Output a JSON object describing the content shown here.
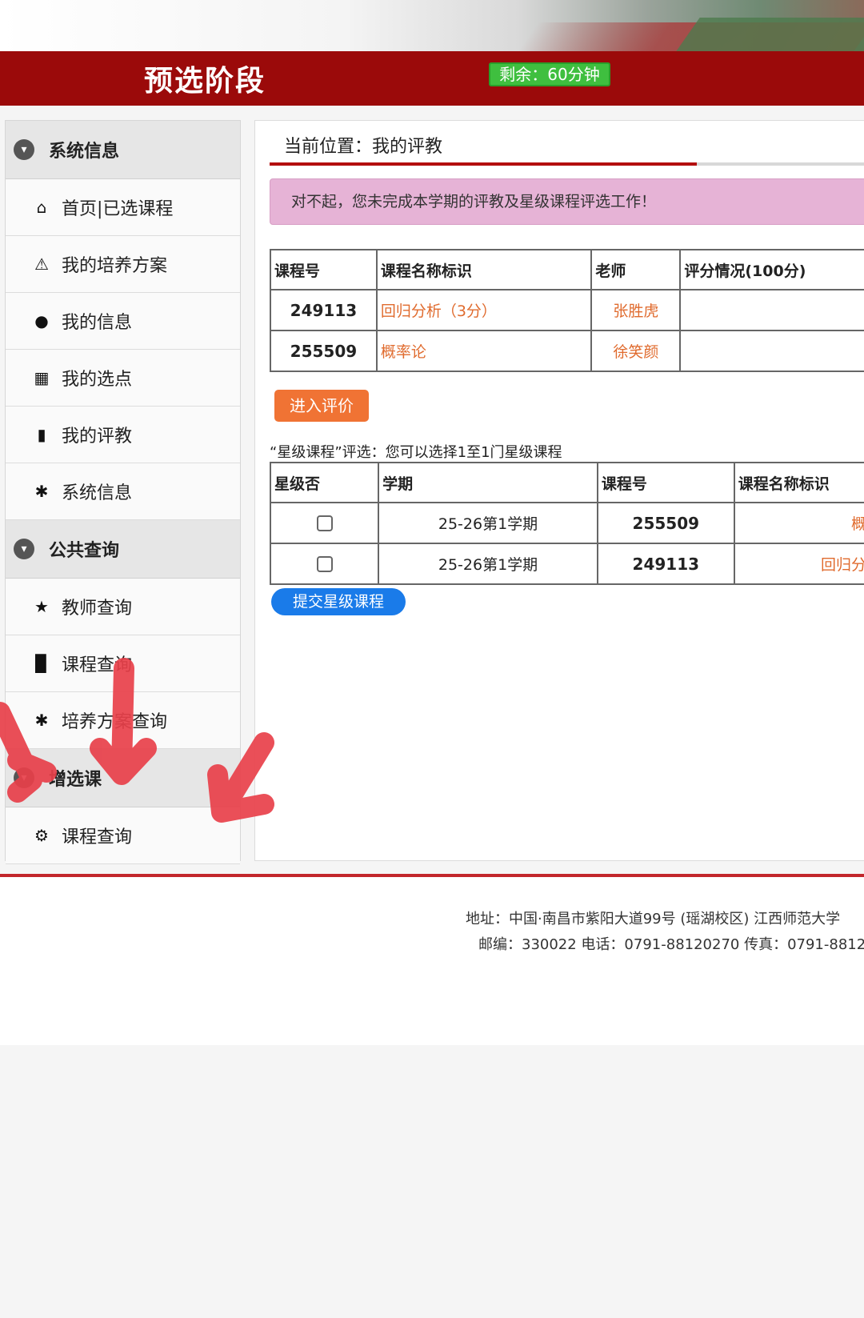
{
  "header": {
    "phase_title": "预选阶段",
    "timer": "剩余：60分钟"
  },
  "sidebar": {
    "groups": [
      {
        "label": "系统信息"
      },
      {
        "label": "公共查询"
      },
      {
        "label": "增选课"
      }
    ],
    "items": [
      {
        "label": "首页|已选课程",
        "icon": "home-icon"
      },
      {
        "label": "我的培养方案",
        "icon": "warning-icon"
      },
      {
        "label": "我的信息",
        "icon": "user-icon"
      },
      {
        "label": "我的选点",
        "icon": "gift-icon"
      },
      {
        "label": "我的评教",
        "icon": "bookmark-icon"
      },
      {
        "label": "系统信息",
        "icon": "asterisk-icon"
      },
      {
        "label": "教师查询",
        "icon": "star-icon"
      },
      {
        "label": "课程查询",
        "icon": "book-icon"
      },
      {
        "label": "培养方案查询",
        "icon": "asterisk-icon"
      },
      {
        "label": "课程查询",
        "icon": "gear-icon"
      }
    ]
  },
  "main": {
    "breadcrumb": "当前位置：我的评教",
    "alert": "对不起，您未完成本学期的评教及星级课程评选工作！",
    "eval_table": {
      "headers": [
        "课程号",
        "课程名称标识",
        "老师",
        "评分情况(100分)"
      ],
      "rows": [
        {
          "code": "249113",
          "name": "回归分析（3分）",
          "teacher": "张胜虎",
          "score": ""
        },
        {
          "code": "255509",
          "name": "概率论",
          "teacher": "徐笑颜",
          "score": ""
        }
      ]
    },
    "eval_button": "进入评价",
    "star_note": "“星级课程”评选：您可以选择1至1门星级课程",
    "star_table": {
      "headers": [
        "星级否",
        "学期",
        "课程号",
        "课程名称标识"
      ],
      "rows": [
        {
          "checked": false,
          "term": "25-26第1学期",
          "code": "255509",
          "name": "概"
        },
        {
          "checked": false,
          "term": "25-26第1学期",
          "code": "249113",
          "name": "回归分"
        }
      ]
    },
    "submit_button": "提交星级课程"
  },
  "footer": {
    "address": "地址：中国·南昌市紫阳大道99号 (瑶湖校区) 江西师范大学",
    "postal": "邮编：330022 电话：0791-88120270 传真：0791-8812"
  },
  "colors": {
    "brand_red": "#9b0a0a",
    "timer_green": "#3fbf3f",
    "alert_pink": "#e6b3d6",
    "eval_orange": "#f07334",
    "submit_blue": "#1a7be9",
    "annotation_arrow": "#e8404a"
  }
}
